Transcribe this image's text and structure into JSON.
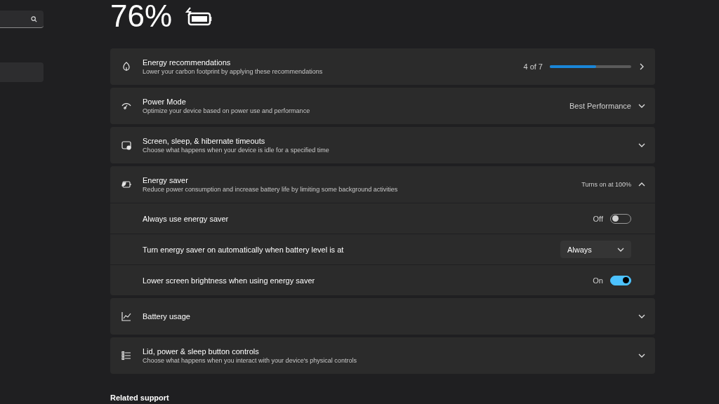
{
  "battery": {
    "percent": "76%",
    "charging": true
  },
  "sidebar": {
    "items": [
      {
        "selected": true
      }
    ]
  },
  "cards": [
    {
      "kind": "progress",
      "title": "Energy recommendations",
      "subtitle": "Lower your carbon footprint by applying these recommendations",
      "value": "4 of 7",
      "level": 0.571
    },
    {
      "kind": "value",
      "title": "Power Mode",
      "subtitle": "Optimize your device based on power use and performance",
      "value": "Best Performance",
      "expanded": false
    },
    {
      "kind": "plain",
      "title": "Screen, sleep, & hibernate timeouts",
      "subtitle": "Choose what happens when your device is idle for a specified time",
      "expanded": false
    },
    {
      "kind": "value",
      "title": "Energy saver",
      "subtitle": "Reduce power consumption and increase battery life by limiting some background activities",
      "value": "Turns on at 100%",
      "expanded": true,
      "children": [
        {
          "kind": "toggle",
          "label": "Always use energy saver",
          "state": "Off",
          "on": false
        },
        {
          "kind": "dropdown",
          "label": "Turn energy saver on automatically when battery level is at",
          "value": "Always"
        },
        {
          "kind": "toggle",
          "label": "Lower screen brightness when using energy saver",
          "state": "On",
          "on": true
        }
      ]
    },
    {
      "kind": "plain",
      "title": "Battery usage",
      "expanded": false
    },
    {
      "kind": "plain",
      "title": "Lid, power & sleep button controls",
      "subtitle": "Choose what happens when you interact with your device's physical controls",
      "expanded": false
    }
  ],
  "related": {
    "title": "Related support"
  }
}
